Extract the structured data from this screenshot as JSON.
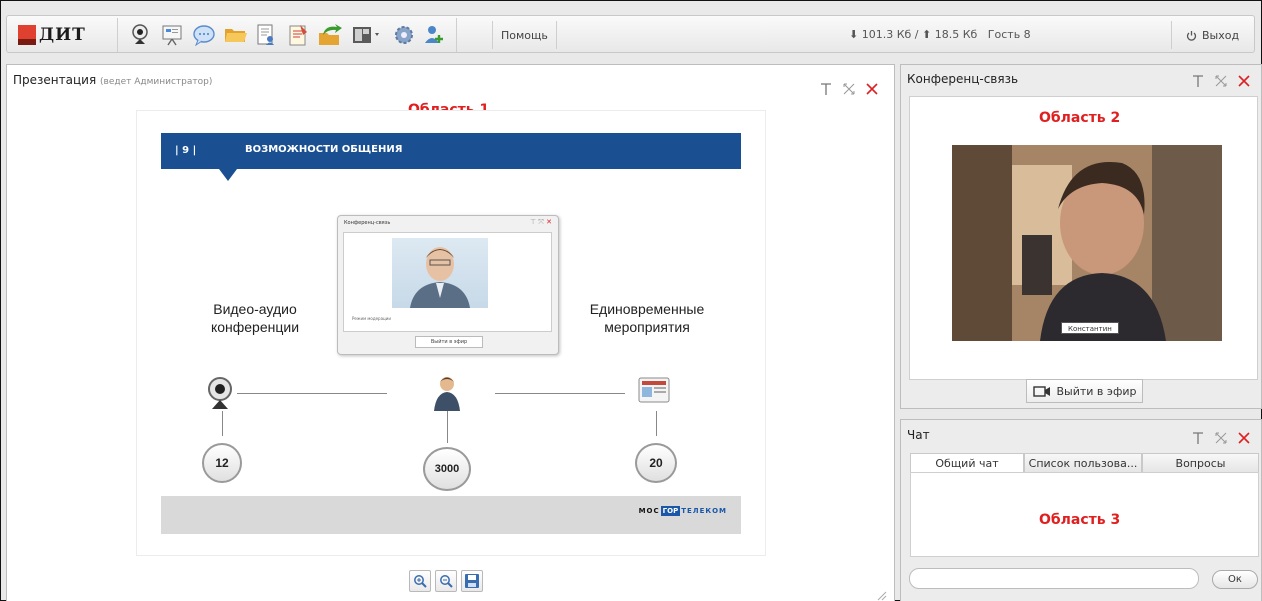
{
  "toolbar": {
    "logo_text": "ДИТ",
    "help_label": "Помощь",
    "traffic": "⬇ 101.3 Кб / ⬆ 18.5 Кб",
    "user": "Гость 8",
    "logout_label": "Выход",
    "icons": [
      "webcam-icon",
      "presentation-icon",
      "chat-bubble-icon",
      "folder-icon",
      "document-user-icon",
      "notepad-icon",
      "share-icon",
      "layout-icon",
      "settings-icon",
      "add-user-icon"
    ]
  },
  "presentation": {
    "title": "Презентация",
    "subtitle": "(ведет Администратор)",
    "area_label": "Область 1",
    "slide": {
      "number": "| 9 |",
      "heading": "ВОЗМОЖНОСТИ ОБЩЕНИЯ",
      "left_text_1": "Видео-аудио",
      "left_text_2": "конференции",
      "right_text_1": "Единовременные",
      "right_text_2": "мероприятия",
      "mini_window_title": "Конференц-связь",
      "mini_window_checkbox": "Режим модерации",
      "mini_window_button": "Выйти в эфир",
      "counts": [
        "12",
        "3000",
        "20"
      ],
      "footer_logo_1": "МОС",
      "footer_logo_2": "ГОР",
      "footer_logo_3": "ТЕЛЕКОМ"
    }
  },
  "conference": {
    "title": "Конференц-связь",
    "area_label": "Область 2",
    "name_tag": "Константин",
    "on_air_label": "Выйти в эфир"
  },
  "chat": {
    "title": "Чат",
    "tabs": [
      "Общий чат",
      "Список пользова...",
      "Вопросы"
    ],
    "area_label": "Область 3",
    "input_value": "",
    "send_label": "Ок"
  },
  "colors": {
    "accent_red": "#e02020",
    "slide_blue": "#1a4f92",
    "close_red": "#e02020"
  }
}
